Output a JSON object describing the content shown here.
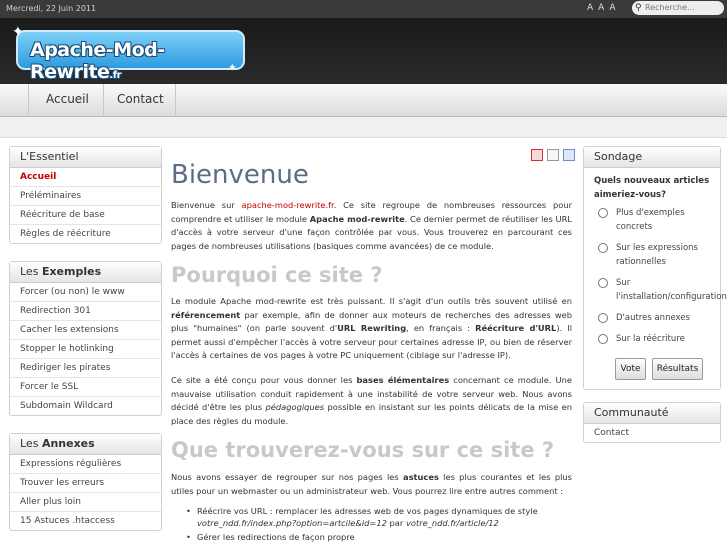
{
  "topbar": {
    "date": "Mercredi, 22 Juin 2011",
    "font_sizes": [
      "A",
      "A",
      "A"
    ],
    "search_placeholder": "Recherche..."
  },
  "logo": {
    "main": "Apache-Mod-Rewrite",
    "ext": ".fr"
  },
  "nav": {
    "items": [
      "Accueil",
      "Contact"
    ]
  },
  "sidebar": {
    "essentiel": {
      "title": "L'Essentiel",
      "items": [
        "Accueil",
        "Préléminaires",
        "Réécriture de base",
        "Règles de réécriture"
      ]
    },
    "exemples": {
      "title_prefix": "Les ",
      "title_strong": "Exemples",
      "items": [
        "Forcer (ou non) le www",
        "Redirection 301",
        "Cacher les extensions",
        "Stopper le hotlinking",
        "Rediriger les pirates",
        "Forcer le SSL",
        "Subdomain Wildcard"
      ]
    },
    "annexes": {
      "title_prefix": "Les ",
      "title_strong": "Annexes",
      "items": [
        "Expressions régulières",
        "Trouver les erreurs",
        "Aller plus loin",
        "15 Astuces .htaccess"
      ]
    }
  },
  "content": {
    "title": "Bienvenue",
    "intro": {
      "t1": "Bienvenue sur ",
      "link": "apache-mod-rewrite.fr",
      "t2": ". Ce site regroupe de nombreuses ressources pour comprendre et utiliser le module ",
      "b1": "Apache mod-rewrite",
      "t3": ". Ce dernier permet de réutiliser les URL d'accès à votre serveur d'une façon contrôlée par vous. Vous trouverez en parcourant ces pages de nombreuses utilisations (basiques comme avancées) de ce module."
    },
    "h2_why": "Pourquoi ce site ?",
    "why_p1": {
      "t1": "Le module Apache mod-rewrite est très puissant. Il s'agit d'un outils très souvent utilisé en ",
      "b1": "référencement",
      "t2": " par exemple, afin de donner aux moteurs de recherches des adresses web plus \"humaines\" (on parle souvent d'",
      "b2": "URL Rewriting",
      "t3": ", en français : ",
      "b3": "Réécriture d'URL",
      "t4": "). Il permet aussi d'empêcher l'accès à votre serveur pour certaines adresse IP, ou bien de réserver l'accès à certaines de vos pages à votre PC uniquement (ciblage sur l'adresse IP)."
    },
    "why_p2": {
      "t1": "Ce site a été conçu pour vous donner les ",
      "b1": "bases élémentaires",
      "t2": " concernant ce module. Une mauvaise utilisation conduit rapidement à une instabilité de votre serveur web. Nous avons décidé d'être les plus ",
      "i1": "pédagogiques",
      "t3": " possible en insistant sur les points délicats de la mise en place des règles du module."
    },
    "h2_what": "Que trouverez-vous sur ce site ?",
    "what_p": {
      "t1": "Nous avons essayer de regrouper sur nos pages les ",
      "b1": "astuces",
      "t2": " les plus courantes et les plus utiles pour un webmaster ou un administrateur web. Vous pourrez lire entre autres comment :"
    },
    "bullets": [
      {
        "t1": "Réécrire vos URL : remplacer les adresses web de vos pages dynamiques de style ",
        "i1": "votre_ndd.fr/index.php?option=artcile&id=12",
        "t2": " par ",
        "i2": "votre_ndd.fr/article/12"
      },
      {
        "t1": "Gérer les redirections de façon propre"
      }
    ]
  },
  "poll": {
    "title": "Sondage",
    "question": "Quels nouveaux articles aimeriez-vous?",
    "options": [
      "Plus d'exemples concrets",
      "Sur les expressions rationnelles",
      "Sur l'installation/configuration",
      "D'autres annexes",
      "Sur la réécriture"
    ],
    "vote_label": "Vote",
    "results_label": "Résultats"
  },
  "community": {
    "title": "Communauté",
    "items": [
      "Contact"
    ]
  }
}
